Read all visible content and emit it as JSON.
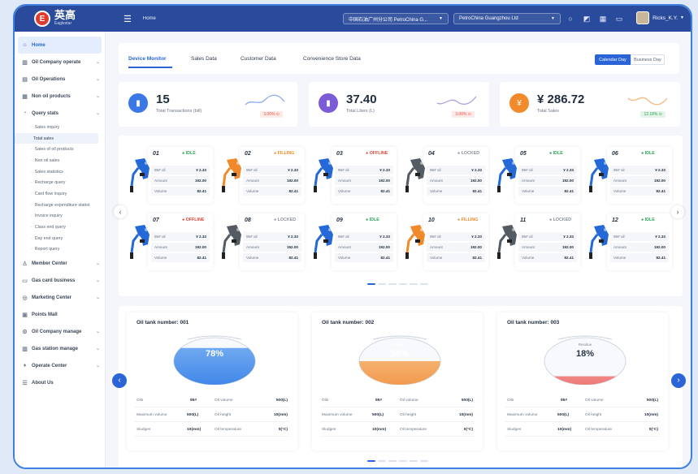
{
  "app": {
    "logo_text": "英高",
    "logo_sub": "Eaglestar",
    "logo_mark": "E",
    "breadcrumb": "Home"
  },
  "topbar": {
    "station_select": "中国石油广州分公司 PetroChina G...",
    "company_select": "PetroChina Guangzhou Ltd",
    "user_name": "Ricks_K.Y."
  },
  "sidebar": {
    "items": [
      {
        "label": "Home",
        "icon": "home-icon",
        "glyph": "⌂"
      },
      {
        "label": "Oil Company operate",
        "icon": "building-icon",
        "glyph": "▥"
      },
      {
        "label": "Oil Operations",
        "icon": "barrel-icon",
        "glyph": "▤"
      },
      {
        "label": "Non oil products",
        "icon": "box-icon",
        "glyph": "▦"
      },
      {
        "label": "Query stats",
        "icon": "chart-icon",
        "glyph": "◔"
      }
    ],
    "subitems": [
      "Sales inquiry",
      "Total sales",
      "Sales of oil products",
      "Non oil sales",
      "Sales statistics",
      "Recharge query",
      "Card flow inquiry",
      "Recharge expenditure statist",
      "Invoice inquiry",
      "Class end query",
      "Day end query",
      "Report query"
    ],
    "bottom_items": [
      {
        "label": "Member Center",
        "icon": "user-icon",
        "glyph": "♙"
      },
      {
        "label": "Gas card business",
        "icon": "card-icon",
        "glyph": "▭"
      },
      {
        "label": "Marketing Center",
        "icon": "target-icon",
        "glyph": "◎"
      },
      {
        "label": "Points Mall",
        "icon": "gift-icon",
        "glyph": "▣"
      },
      {
        "label": "Oil Company manage",
        "icon": "settings-icon",
        "glyph": "⚙"
      },
      {
        "label": "Gas station manage",
        "icon": "station-icon",
        "glyph": "▥"
      },
      {
        "label": "Operate Center",
        "icon": "operate-icon",
        "glyph": "♦"
      },
      {
        "label": "About Us",
        "icon": "info-icon",
        "glyph": "☰"
      }
    ]
  },
  "tabs": [
    "Device Monitor",
    "Sales Data",
    "Customer Data",
    "Convenience Store Data"
  ],
  "day_toggle": [
    "Calendar Day",
    "Business Day"
  ],
  "stats": [
    {
      "value": "15",
      "label": "Total Transactions (bill)",
      "badge": "3.00% ⊙",
      "color": "#3a78e6",
      "badge_color": "#e35a48",
      "badge_bg": "#fde9e6",
      "glyph": "▮"
    },
    {
      "value": "37.40",
      "label": "Total Liters (L)",
      "badge": "3.09% ⊙",
      "color": "#7b5bd6",
      "badge_color": "#e35a48",
      "badge_bg": "#fde9e6",
      "glyph": "▮"
    },
    {
      "value": "¥ 286.72",
      "label": "Total Sales",
      "badge": "12.18% ⊙",
      "color": "#f08a2a",
      "badge_color": "#2f9e53",
      "badge_bg": "#e3f5e8",
      "glyph": "¥"
    }
  ],
  "pump_labels": {
    "oil": "95# oil",
    "amount": "Amount",
    "volume": "Volume"
  },
  "pumps": [
    {
      "num": "01",
      "status": "IDLE",
      "price": "¥ 2.33",
      "amount": "192.00",
      "volume": "82.41",
      "color": "#2568d8",
      "status_color": "#2ea35b"
    },
    {
      "num": "02",
      "status": "FILLING",
      "price": "¥ 2.33",
      "amount": "192.00",
      "volume": "82.41",
      "color": "#f0892a",
      "status_color": "#f0892a"
    },
    {
      "num": "03",
      "status": "OFFLINE",
      "price": "¥ 2.33",
      "amount": "192.00",
      "volume": "82.41",
      "color": "#2568d8",
      "status_color": "#e0483a"
    },
    {
      "num": "04",
      "status": "LOCKED",
      "price": "¥ 2.33",
      "amount": "192.00",
      "volume": "82.41",
      "color": "#555b63",
      "status_color": "#8a9099"
    },
    {
      "num": "05",
      "status": "IDLE",
      "price": "¥ 2.33",
      "amount": "192.00",
      "volume": "82.41",
      "color": "#2568d8",
      "status_color": "#2ea35b"
    },
    {
      "num": "06",
      "status": "IDLE",
      "price": "¥ 2.33",
      "amount": "192.00",
      "volume": "82.41",
      "color": "#2568d8",
      "status_color": "#2ea35b"
    },
    {
      "num": "07",
      "status": "OFFLINE",
      "price": "¥ 2.33",
      "amount": "192.00",
      "volume": "82.41",
      "color": "#2568d8",
      "status_color": "#e0483a"
    },
    {
      "num": "08",
      "status": "LOCKED",
      "price": "¥ 2.33",
      "amount": "192.00",
      "volume": "82.41",
      "color": "#555b63",
      "status_color": "#8a9099"
    },
    {
      "num": "09",
      "status": "IDLE",
      "price": "¥ 2.33",
      "amount": "192.00",
      "volume": "82.41",
      "color": "#2568d8",
      "status_color": "#2ea35b"
    },
    {
      "num": "10",
      "status": "FILLING",
      "price": "¥ 2.33",
      "amount": "192.00",
      "volume": "82.41",
      "color": "#f0892a",
      "status_color": "#f0892a"
    },
    {
      "num": "11",
      "status": "LOCKED",
      "price": "¥ 2.33",
      "amount": "192.00",
      "volume": "82.41",
      "color": "#555b63",
      "status_color": "#8a9099"
    },
    {
      "num": "12",
      "status": "IDLE",
      "price": "¥ 2.33",
      "amount": "192.00",
      "volume": "82.41",
      "color": "#2568d8",
      "status_color": "#2ea35b"
    }
  ],
  "tank_labels": {
    "residue": "Residue",
    "oils": "Oils",
    "oil_volume": "Oil volume",
    "max_volume": "Maximum volume",
    "oil_height": "Oil height",
    "sludges": "Sludges",
    "oil_temperature": "Oil temperature"
  },
  "tanks": [
    {
      "title": "Oil tank number: 001",
      "percent": "78%",
      "fill_fraction": 0.78,
      "color": "#2f7be6",
      "color_light": "#6fa8f0",
      "oils": "95#",
      "oil_volume": "500(L)",
      "max_volume": "500(L)",
      "oil_height": "10(mm)",
      "sludges": "10(mm)",
      "oil_temperature": "0(°C)"
    },
    {
      "title": "Oil tank number: 002",
      "percent": "50%",
      "fill_fraction": 0.5,
      "color": "#ee8128",
      "color_light": "#f6b06e",
      "oils": "95#",
      "oil_volume": "500(L)",
      "max_volume": "500(L)",
      "oil_height": "10(mm)",
      "sludges": "10(mm)",
      "oil_temperature": "0(°C)"
    },
    {
      "title": "Oil tank number: 003",
      "percent": "18%",
      "fill_fraction": 0.18,
      "color": "#e0302c",
      "color_light": "#f08783",
      "oils": "95#",
      "oil_volume": "500(L)",
      "max_volume": "500(L)",
      "oil_height": "10(mm)",
      "sludges": "10(mm)",
      "oil_temperature": "0(°C)"
    }
  ]
}
